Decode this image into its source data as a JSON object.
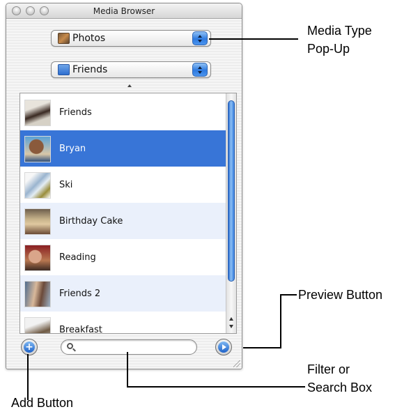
{
  "window": {
    "title": "Media Browser"
  },
  "media_type_popup": {
    "selected": "Photos",
    "icon": "photos-icon"
  },
  "album_popup": {
    "selected": "Friends",
    "icon": "folder-icon"
  },
  "list": {
    "items": [
      {
        "label": "Friends",
        "selected": false
      },
      {
        "label": "Bryan",
        "selected": true
      },
      {
        "label": "Ski",
        "selected": false
      },
      {
        "label": "Birthday Cake",
        "selected": false
      },
      {
        "label": "Reading",
        "selected": false
      },
      {
        "label": "Friends 2",
        "selected": false
      },
      {
        "label": "Breakfast",
        "selected": false
      }
    ],
    "selection_color": "#3875d7",
    "alt_row_color": "#eaf0fb"
  },
  "search": {
    "placeholder": ""
  },
  "callouts": {
    "media_type_line1": "Media Type",
    "media_type_line2": "Pop-Up",
    "preview": "Preview Button",
    "filter_line1": "Filter or",
    "filter_line2": "Search Box",
    "add": "Add Button"
  }
}
